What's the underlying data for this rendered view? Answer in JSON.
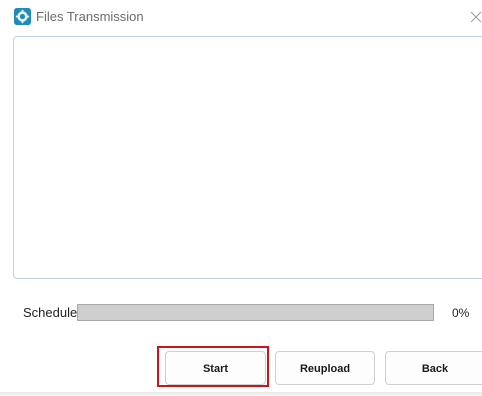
{
  "window": {
    "title": "Files Transmission",
    "app_icon": "app-icon",
    "close_icon": "close-icon"
  },
  "log": {
    "content": ""
  },
  "schedule": {
    "label": "Schedule",
    "progress_percent": 0,
    "progress_text": "0%"
  },
  "buttons": {
    "start_label": "Start",
    "reupload_label": "Reupload",
    "back_label": "Back"
  },
  "colors": {
    "accent_highlight": "#c8161d",
    "log_border": "#bcd4e2",
    "progress_track": "#cfcfcf"
  }
}
